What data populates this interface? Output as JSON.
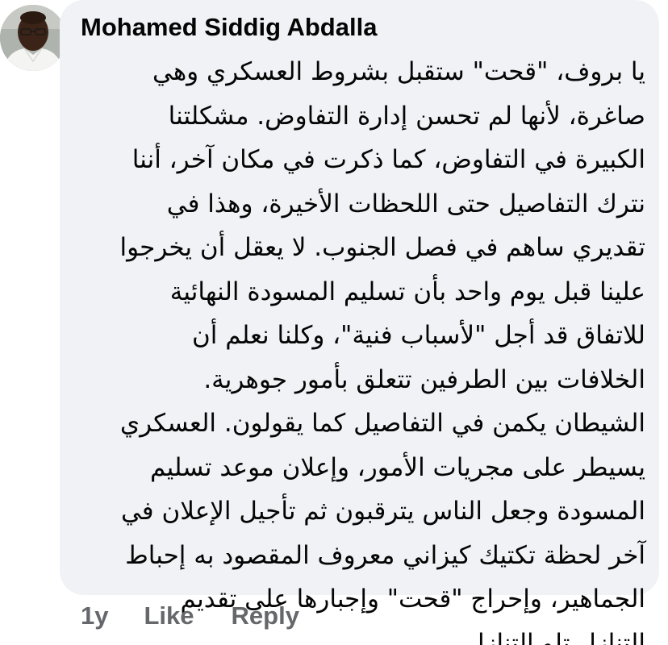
{
  "comment": {
    "author": "Mohamed Siddig Abdalla",
    "body_lines": [
      "يا بروف، \"قحت\" ستقبل بشروط العسكري وهي",
      "صاغرة، لأنها لم تحسن إدارة التفاوض. مشكلتنا",
      "الكبيرة في التفاوض، كما ذكرت في مكان آخر، أننا",
      "نترك التفاصيل حتى اللحظات الأخيرة، وهذا في",
      "تقديري ساهم في فصل الجنوب. لا يعقل أن يخرجوا",
      "علينا قبل يوم واحد بأن تسليم المسودة النهائية",
      "للاتفاق قد أجل \"لأسباب فنية\"، وكلنا نعلم أن",
      "الخلافات بين الطرفين تتعلق بأمور جوهرية.",
      "الشيطان يكمن في التفاصيل كما يقولون. العسكري",
      "يسيطر على مجريات الأمور، وإعلان موعد تسليم",
      "المسودة وجعل الناس يترقبون ثم تأجيل الإعلان في",
      "آخر لحظة تكتيك كيزاني معروف المقصود به إحباط",
      "الجماهير، وإحراج \"قحت\" وإجبارها على تقديم",
      "التنازل تلو التنازل."
    ],
    "timestamp": "1y",
    "like_label": "Like",
    "reply_label": "Reply"
  },
  "colors": {
    "bubble_background": "#f0f2f5",
    "text": "#050505",
    "action_text": "#65676b"
  }
}
